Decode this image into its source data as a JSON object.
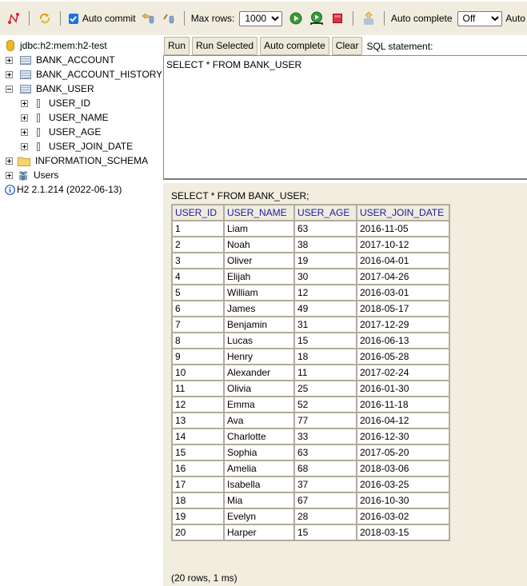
{
  "toolbar": {
    "icons": [
      "disconnect-icon",
      "refresh-icon",
      "rollback-icon",
      "commit-icon",
      "run-icon",
      "run-selected-icon",
      "stop-icon",
      "history-icon"
    ],
    "auto_commit_label": "Auto commit",
    "auto_commit_checked": true,
    "max_rows_label": "Max rows:",
    "max_rows_value": "1000",
    "auto_complete_label": "Auto complete",
    "auto_complete_value": "Off",
    "auto_select_label": "Auto"
  },
  "sidebar": {
    "connection": "jdbc:h2:mem:h2-test",
    "tables": [
      {
        "name": "BANK_ACCOUNT",
        "expanded": false
      },
      {
        "name": "BANK_ACCOUNT_HISTORY",
        "expanded": false
      },
      {
        "name": "BANK_USER",
        "expanded": true
      }
    ],
    "columns": [
      "USER_ID",
      "USER_NAME",
      "USER_AGE",
      "USER_JOIN_DATE"
    ],
    "schema": "INFORMATION_SCHEMA",
    "users": "Users",
    "version": "H2 2.1.214 (2022-06-13)"
  },
  "editor": {
    "buttons": {
      "run": "Run",
      "run_selected": "Run Selected",
      "auto_complete": "Auto complete",
      "clear": "Clear"
    },
    "sql_label": "SQL statement:",
    "sql_text": "SELECT * FROM BANK_USER"
  },
  "result": {
    "statement": "SELECT * FROM BANK_USER;",
    "headers": [
      "USER_ID",
      "USER_NAME",
      "USER_AGE",
      "USER_JOIN_DATE"
    ],
    "rows": [
      [
        "1",
        "Liam",
        "63",
        "2016-11-05"
      ],
      [
        "2",
        "Noah",
        "38",
        "2017-10-12"
      ],
      [
        "3",
        "Oliver",
        "19",
        "2016-04-01"
      ],
      [
        "4",
        "Elijah",
        "30",
        "2017-04-26"
      ],
      [
        "5",
        "William",
        "12",
        "2016-03-01"
      ],
      [
        "6",
        "James",
        "49",
        "2018-05-17"
      ],
      [
        "7",
        "Benjamin",
        "31",
        "2017-12-29"
      ],
      [
        "8",
        "Lucas",
        "15",
        "2016-06-13"
      ],
      [
        "9",
        "Henry",
        "18",
        "2016-05-28"
      ],
      [
        "10",
        "Alexander",
        "11",
        "2017-02-24"
      ],
      [
        "11",
        "Olivia",
        "25",
        "2016-01-30"
      ],
      [
        "12",
        "Emma",
        "52",
        "2016-11-18"
      ],
      [
        "13",
        "Ava",
        "77",
        "2016-04-12"
      ],
      [
        "14",
        "Charlotte",
        "33",
        "2016-12-30"
      ],
      [
        "15",
        "Sophia",
        "63",
        "2017-05-20"
      ],
      [
        "16",
        "Amelia",
        "68",
        "2018-03-06"
      ],
      [
        "17",
        "Isabella",
        "37",
        "2016-03-25"
      ],
      [
        "18",
        "Mia",
        "67",
        "2016-10-30"
      ],
      [
        "19",
        "Evelyn",
        "28",
        "2016-03-02"
      ],
      [
        "20",
        "Harper",
        "15",
        "2018-03-15"
      ]
    ],
    "footer": "(20 rows, 1 ms)"
  }
}
